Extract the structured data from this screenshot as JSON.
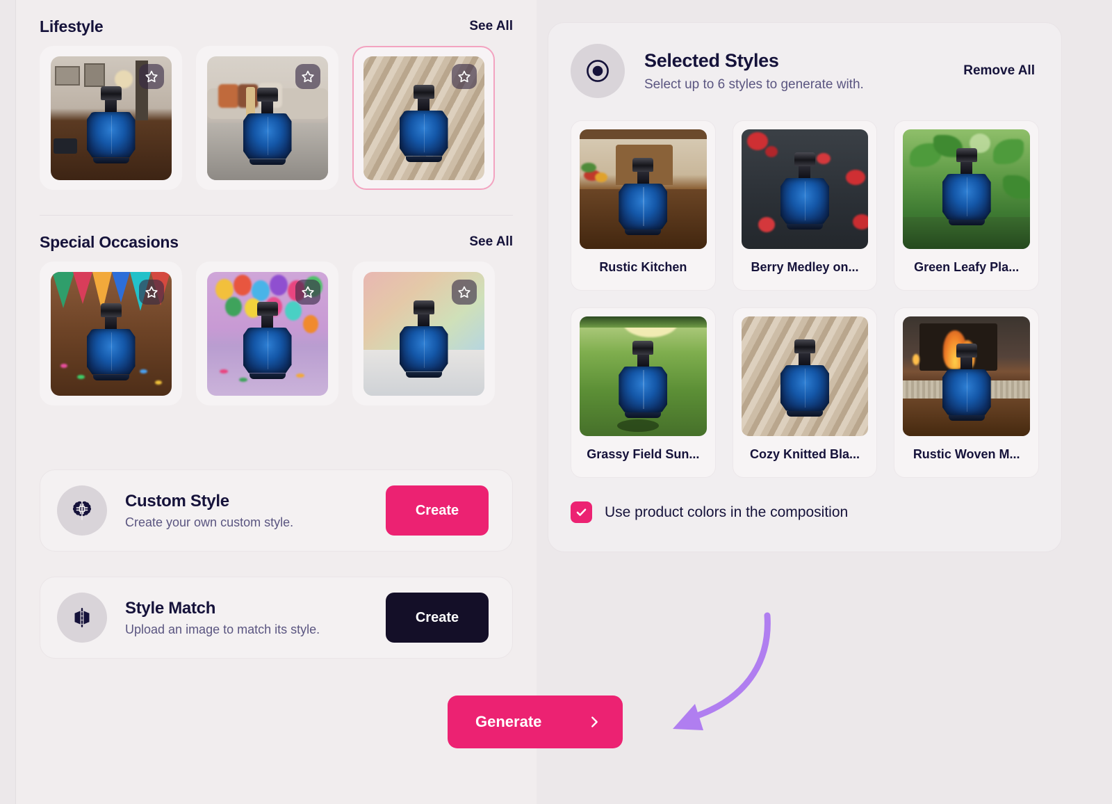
{
  "theme": {
    "page_bg": "#ece8ea",
    "panel_bg": "#f1edee",
    "accent_pink": "#ec2272",
    "dark": "#140f28",
    "selected_border": "#f3a3c0",
    "annotation_arrow": "#b07ef0"
  },
  "left": {
    "sections": [
      {
        "title": "Lifestyle",
        "see_all": "See All",
        "cards": [
          {
            "scene": "sc-office",
            "favorite_icon": "star-icon",
            "selected": false
          },
          {
            "scene": "sc-living",
            "favorite_icon": "star-icon",
            "selected": false
          },
          {
            "scene": "sc-knit",
            "favorite_icon": "star-icon",
            "selected": true
          }
        ]
      },
      {
        "title": "Special Occasions",
        "see_all": "See All",
        "cards": [
          {
            "scene": "sc-party",
            "favorite_icon": "star-icon",
            "selected": false
          },
          {
            "scene": "sc-balloon",
            "favorite_icon": "star-icon",
            "selected": false
          },
          {
            "scene": "sc-gradient",
            "favorite_icon": "star-icon",
            "selected": false
          }
        ]
      }
    ],
    "options": [
      {
        "icon": "brain-circuit-icon",
        "title": "Custom Style",
        "subtitle": "Create your own custom style.",
        "button_label": "Create",
        "button_variant": "pink"
      },
      {
        "icon": "mirror-flip-icon",
        "title": "Style Match",
        "subtitle": "Upload an image to match its style.",
        "button_label": "Create",
        "button_variant": "dark"
      }
    ]
  },
  "right": {
    "icon": "target-dot-icon",
    "title": "Selected Styles",
    "subtitle": "Select up to 6 styles to generate with.",
    "remove_all": "Remove All",
    "max_styles": 6,
    "styles": [
      {
        "label": "Rustic Kitchen",
        "scene": "sc-kitchen"
      },
      {
        "label": "Berry Medley on...",
        "scene": "sc-berry"
      },
      {
        "label": "Green Leafy Pla...",
        "scene": "sc-leaf"
      },
      {
        "label": "Grassy Field Sun...",
        "scene": "sc-grass"
      },
      {
        "label": "Cozy Knitted Bla...",
        "scene": "sc-knit"
      },
      {
        "label": "Rustic Woven M...",
        "scene": "sc-fire"
      }
    ],
    "checkbox": {
      "label": "Use product colors in the composition",
      "checked": true,
      "icon": "check-icon"
    }
  },
  "footer": {
    "generate_label": "Generate",
    "generate_icon": "chevron-right-icon"
  }
}
